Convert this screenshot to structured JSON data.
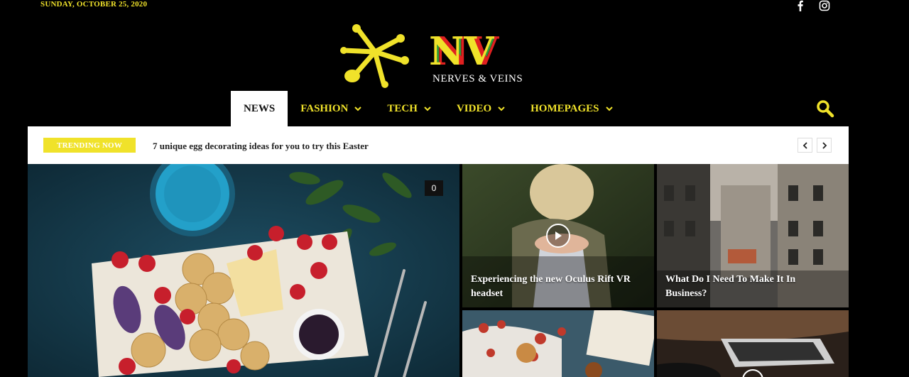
{
  "topbar": {
    "date": "SUNDAY, OCTOBER 25, 2020"
  },
  "logo": {
    "letters": "NV",
    "tagline": "NERVES & VEINS"
  },
  "nav": {
    "items": [
      {
        "label": "NEWS"
      },
      {
        "label": "FASHION"
      },
      {
        "label": "TECH"
      },
      {
        "label": "VIDEO"
      },
      {
        "label": "HOMEPAGES"
      }
    ]
  },
  "trending": {
    "badge": "TRENDING NOW",
    "headline": "7 unique egg decorating ideas for you to try this Easter"
  },
  "featured": {
    "comment_count": "0"
  },
  "tiles": [
    {
      "title": "Experiencing the new Oculus Rift VR headset"
    },
    {
      "title": "What Do I Need To Make It In Business?"
    }
  ],
  "colors": {
    "accent": "#f0e22a",
    "background": "#000000"
  },
  "icons": [
    "facebook-icon",
    "instagram-icon",
    "chevron-down-icon",
    "search-icon",
    "chevron-left-icon",
    "chevron-right-icon",
    "play-icon"
  ]
}
